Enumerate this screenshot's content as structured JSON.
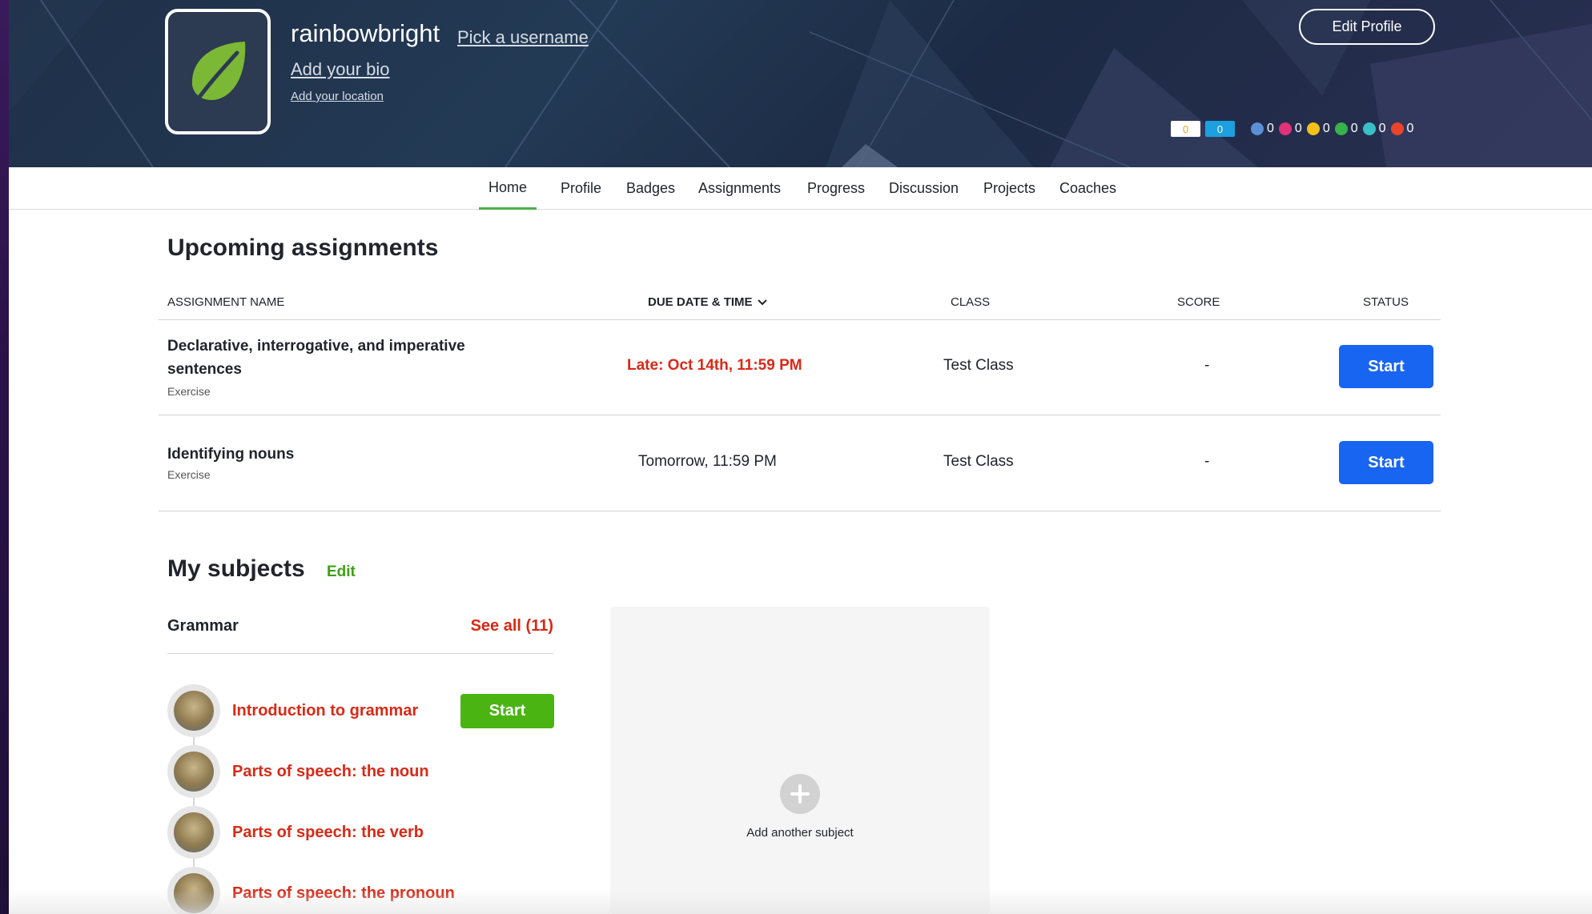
{
  "profile": {
    "username": "rainbowbright",
    "pick_username": "Pick a username",
    "add_bio": "Add your bio",
    "add_location": "Add your location",
    "edit_profile": "Edit Profile",
    "energy_points": "0",
    "points": "0",
    "badges": [
      {
        "icon": "meteorite-badge-icon",
        "count": "0",
        "color": "#5b8fd6"
      },
      {
        "icon": "moon-badge-icon",
        "count": "0",
        "color": "#e0327a"
      },
      {
        "icon": "earth-badge-icon",
        "count": "0",
        "color": "#f3c01c"
      },
      {
        "icon": "sun-badge-icon",
        "count": "0",
        "color": "#38b24a"
      },
      {
        "icon": "black-hole-badge-icon",
        "count": "0",
        "color": "#38c0c8"
      },
      {
        "icon": "challenge-patch-icon",
        "count": "0",
        "color": "#e8452c"
      }
    ]
  },
  "nav": {
    "items": [
      "Home",
      "Profile",
      "Badges",
      "Assignments",
      "Progress",
      "Discussion",
      "Projects",
      "Coaches"
    ],
    "active": "Home"
  },
  "assignments": {
    "heading": "Upcoming assignments",
    "columns": {
      "name": "ASSIGNMENT NAME",
      "due": "DUE DATE & TIME",
      "class": "CLASS",
      "score": "SCORE",
      "status": "STATUS"
    },
    "rows": [
      {
        "name_line1": "Declarative, interrogative, and imperative",
        "name_line2": "sentences",
        "type": "Exercise",
        "due": "Late: Oct 14th, 11:59 PM",
        "class": "Test Class",
        "score": "-",
        "action": "Start"
      },
      {
        "name_line1": "Identifying nouns",
        "type": "Exercise",
        "due": "Tomorrow, 11:59 PM",
        "class": "Test Class",
        "score": "-",
        "action": "Start"
      }
    ]
  },
  "subjects": {
    "heading": "My subjects",
    "edit": "Edit",
    "subject": {
      "name": "Grammar",
      "see_all": "See all (11)",
      "topics": [
        "Introduction to grammar",
        "Parts of speech: the noun",
        "Parts of speech: the verb",
        "Parts of speech: the pronoun"
      ],
      "start": "Start"
    },
    "add_subject": "Add another subject"
  },
  "colors": {
    "accent_blue": "#1865f2",
    "accent_green": "#4ab512",
    "link_red": "#d92916"
  }
}
